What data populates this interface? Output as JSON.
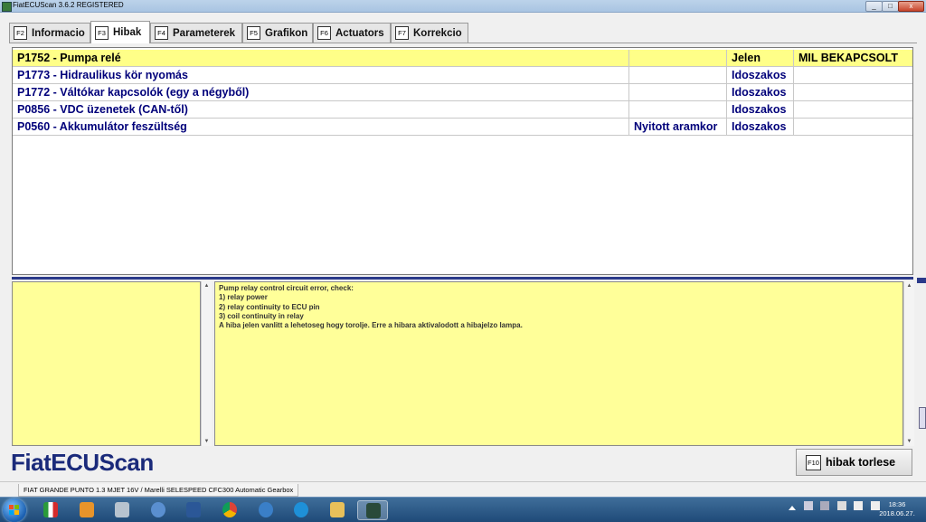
{
  "window": {
    "title": "FiatECUScan 3.6.2 REGISTERED",
    "min_label": "_",
    "max_label": "□",
    "close_label": "x"
  },
  "tabs": [
    {
      "key": "F2",
      "label": "Informacio",
      "active": false
    },
    {
      "key": "F3",
      "label": "Hibak",
      "active": true
    },
    {
      "key": "F4",
      "label": "Parameterek",
      "active": false
    },
    {
      "key": "F5",
      "label": "Grafikon",
      "active": false
    },
    {
      "key": "F6",
      "label": "Actuators",
      "active": false
    },
    {
      "key": "F7",
      "label": "Korrekcio",
      "active": false
    }
  ],
  "faults": [
    {
      "code": "P1752 - Pumpa relé",
      "type": "",
      "status": "Jelen",
      "mil": "MIL BEKAPCSOLT"
    },
    {
      "code": "P1773 - Hidraulikus kör nyomás",
      "type": "",
      "status": "Idoszakos",
      "mil": ""
    },
    {
      "code": "P1772 - Váltókar kapcsolók (egy a négyből)",
      "type": "",
      "status": "Idoszakos",
      "mil": ""
    },
    {
      "code": "P0856 - VDC üzenetek (CAN-től)",
      "type": "",
      "status": "Idoszakos",
      "mil": ""
    },
    {
      "code": "P0560 - Akkumulátor feszültség",
      "type": "Nyitott aramkor",
      "status": "Idoszakos",
      "mil": ""
    }
  ],
  "description": {
    "lines": [
      "Pump relay control circuit error, check:",
      "1) relay power",
      "2) relay continuity to ECU pin",
      "3) coil continuity in relay",
      "A hiba jelen vanlitt a lehetoseg hogy torolje. Erre a hibara aktivalodott a hibajelzo lampa."
    ]
  },
  "logo": "FiatECUScan",
  "clear_button": {
    "key": "F10",
    "label": "hibak torlese"
  },
  "status_bar": "FIAT GRANDE PUNTO 1.3 MJET 16V / Marelli SELESPEED CFC300 Automatic Gearbox",
  "clock": {
    "time": "18:36",
    "date": "2018.06.27."
  },
  "colors": {
    "selected_row": "#ffff88",
    "panel_yellow": "#ffff99",
    "fault_text": "#00007a",
    "logo": "#1a2a7a"
  }
}
